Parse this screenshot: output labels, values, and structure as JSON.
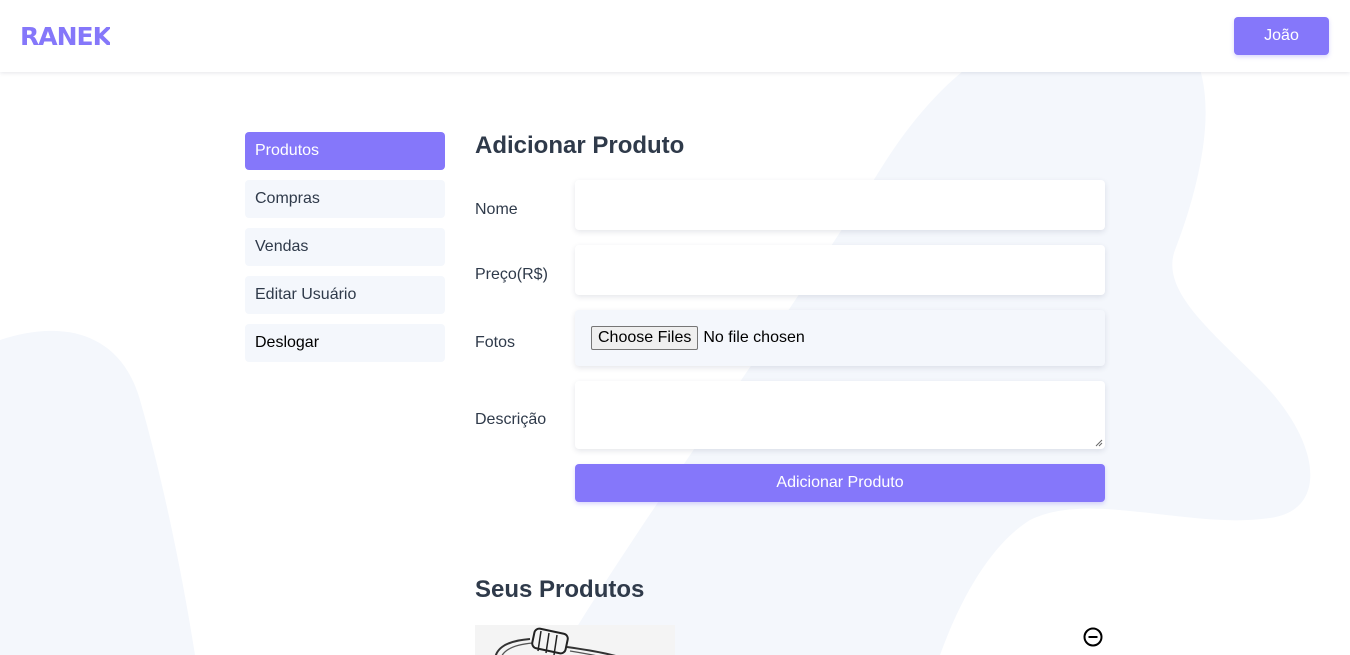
{
  "header": {
    "logo_text": "RANEK",
    "user_button_label": "João"
  },
  "colors": {
    "accent": "#8577fa",
    "sidebar_bg": "#f4f7fc",
    "text": "#2f3a4a"
  },
  "sidebar": {
    "items": [
      {
        "label": "Produtos",
        "active": true
      },
      {
        "label": "Compras",
        "active": false
      },
      {
        "label": "Vendas",
        "active": false
      },
      {
        "label": "Editar Usuário",
        "active": false
      },
      {
        "label": "Deslogar",
        "active": false
      }
    ]
  },
  "form": {
    "title": "Adicionar Produto",
    "fields": {
      "nome": {
        "label": "Nome",
        "value": ""
      },
      "preco": {
        "label": "Preço(R$)",
        "value": ""
      },
      "fotos": {
        "label": "Fotos",
        "button_label": "Choose Files",
        "status": "No file chosen"
      },
      "descricao": {
        "label": "Descrição",
        "value": ""
      }
    },
    "submit_label": "Adicionar Produto"
  },
  "products": {
    "title": "Seus Produtos",
    "items": [
      {
        "thumbnail_icon": "product-image-icon",
        "remove_icon": "minus-circle-icon"
      }
    ]
  }
}
